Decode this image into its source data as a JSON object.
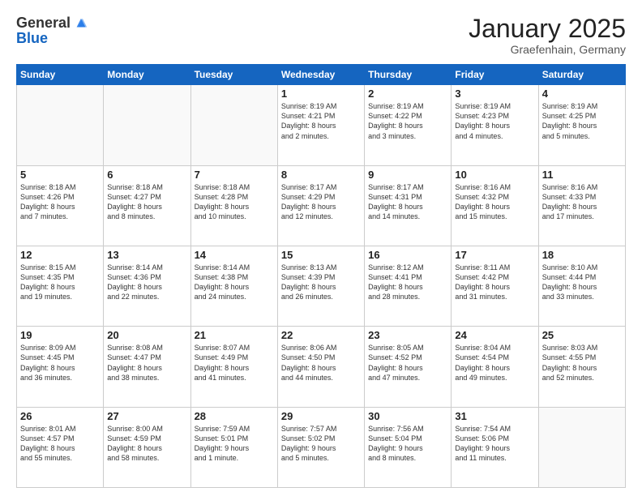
{
  "logo": {
    "general": "General",
    "blue": "Blue"
  },
  "title": "January 2025",
  "location": "Graefenhain, Germany",
  "days": [
    "Sunday",
    "Monday",
    "Tuesday",
    "Wednesday",
    "Thursday",
    "Friday",
    "Saturday"
  ],
  "weeks": [
    [
      {
        "num": "",
        "text": ""
      },
      {
        "num": "",
        "text": ""
      },
      {
        "num": "",
        "text": ""
      },
      {
        "num": "1",
        "text": "Sunrise: 8:19 AM\nSunset: 4:21 PM\nDaylight: 8 hours\nand 2 minutes."
      },
      {
        "num": "2",
        "text": "Sunrise: 8:19 AM\nSunset: 4:22 PM\nDaylight: 8 hours\nand 3 minutes."
      },
      {
        "num": "3",
        "text": "Sunrise: 8:19 AM\nSunset: 4:23 PM\nDaylight: 8 hours\nand 4 minutes."
      },
      {
        "num": "4",
        "text": "Sunrise: 8:19 AM\nSunset: 4:25 PM\nDaylight: 8 hours\nand 5 minutes."
      }
    ],
    [
      {
        "num": "5",
        "text": "Sunrise: 8:18 AM\nSunset: 4:26 PM\nDaylight: 8 hours\nand 7 minutes."
      },
      {
        "num": "6",
        "text": "Sunrise: 8:18 AM\nSunset: 4:27 PM\nDaylight: 8 hours\nand 8 minutes."
      },
      {
        "num": "7",
        "text": "Sunrise: 8:18 AM\nSunset: 4:28 PM\nDaylight: 8 hours\nand 10 minutes."
      },
      {
        "num": "8",
        "text": "Sunrise: 8:17 AM\nSunset: 4:29 PM\nDaylight: 8 hours\nand 12 minutes."
      },
      {
        "num": "9",
        "text": "Sunrise: 8:17 AM\nSunset: 4:31 PM\nDaylight: 8 hours\nand 14 minutes."
      },
      {
        "num": "10",
        "text": "Sunrise: 8:16 AM\nSunset: 4:32 PM\nDaylight: 8 hours\nand 15 minutes."
      },
      {
        "num": "11",
        "text": "Sunrise: 8:16 AM\nSunset: 4:33 PM\nDaylight: 8 hours\nand 17 minutes."
      }
    ],
    [
      {
        "num": "12",
        "text": "Sunrise: 8:15 AM\nSunset: 4:35 PM\nDaylight: 8 hours\nand 19 minutes."
      },
      {
        "num": "13",
        "text": "Sunrise: 8:14 AM\nSunset: 4:36 PM\nDaylight: 8 hours\nand 22 minutes."
      },
      {
        "num": "14",
        "text": "Sunrise: 8:14 AM\nSunset: 4:38 PM\nDaylight: 8 hours\nand 24 minutes."
      },
      {
        "num": "15",
        "text": "Sunrise: 8:13 AM\nSunset: 4:39 PM\nDaylight: 8 hours\nand 26 minutes."
      },
      {
        "num": "16",
        "text": "Sunrise: 8:12 AM\nSunset: 4:41 PM\nDaylight: 8 hours\nand 28 minutes."
      },
      {
        "num": "17",
        "text": "Sunrise: 8:11 AM\nSunset: 4:42 PM\nDaylight: 8 hours\nand 31 minutes."
      },
      {
        "num": "18",
        "text": "Sunrise: 8:10 AM\nSunset: 4:44 PM\nDaylight: 8 hours\nand 33 minutes."
      }
    ],
    [
      {
        "num": "19",
        "text": "Sunrise: 8:09 AM\nSunset: 4:45 PM\nDaylight: 8 hours\nand 36 minutes."
      },
      {
        "num": "20",
        "text": "Sunrise: 8:08 AM\nSunset: 4:47 PM\nDaylight: 8 hours\nand 38 minutes."
      },
      {
        "num": "21",
        "text": "Sunrise: 8:07 AM\nSunset: 4:49 PM\nDaylight: 8 hours\nand 41 minutes."
      },
      {
        "num": "22",
        "text": "Sunrise: 8:06 AM\nSunset: 4:50 PM\nDaylight: 8 hours\nand 44 minutes."
      },
      {
        "num": "23",
        "text": "Sunrise: 8:05 AM\nSunset: 4:52 PM\nDaylight: 8 hours\nand 47 minutes."
      },
      {
        "num": "24",
        "text": "Sunrise: 8:04 AM\nSunset: 4:54 PM\nDaylight: 8 hours\nand 49 minutes."
      },
      {
        "num": "25",
        "text": "Sunrise: 8:03 AM\nSunset: 4:55 PM\nDaylight: 8 hours\nand 52 minutes."
      }
    ],
    [
      {
        "num": "26",
        "text": "Sunrise: 8:01 AM\nSunset: 4:57 PM\nDaylight: 8 hours\nand 55 minutes."
      },
      {
        "num": "27",
        "text": "Sunrise: 8:00 AM\nSunset: 4:59 PM\nDaylight: 8 hours\nand 58 minutes."
      },
      {
        "num": "28",
        "text": "Sunrise: 7:59 AM\nSunset: 5:01 PM\nDaylight: 9 hours\nand 1 minute."
      },
      {
        "num": "29",
        "text": "Sunrise: 7:57 AM\nSunset: 5:02 PM\nDaylight: 9 hours\nand 5 minutes."
      },
      {
        "num": "30",
        "text": "Sunrise: 7:56 AM\nSunset: 5:04 PM\nDaylight: 9 hours\nand 8 minutes."
      },
      {
        "num": "31",
        "text": "Sunrise: 7:54 AM\nSunset: 5:06 PM\nDaylight: 9 hours\nand 11 minutes."
      },
      {
        "num": "",
        "text": ""
      }
    ]
  ]
}
